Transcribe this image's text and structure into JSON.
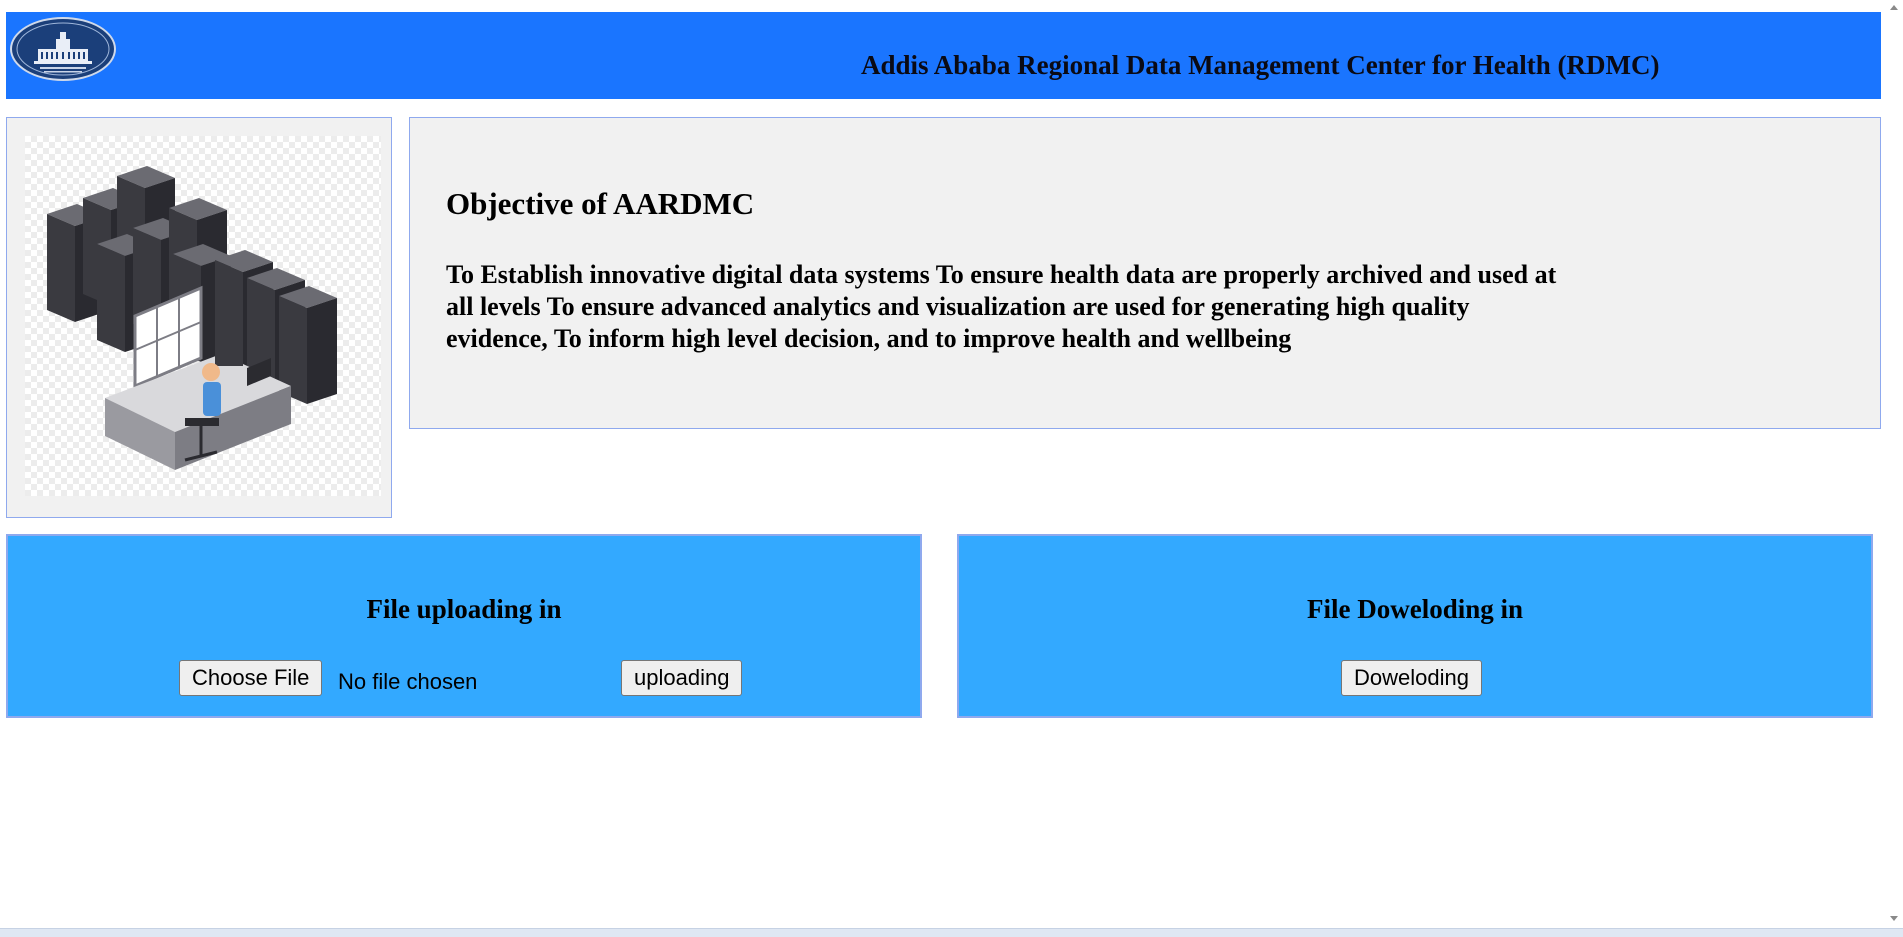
{
  "header": {
    "title": "Addis Ababa Regional Data Management Center for Health (RDMC)",
    "logo_icon": "building-seal-logo"
  },
  "hero": {
    "illustration_icon": "server-room-illustration"
  },
  "objective": {
    "heading": "Objective of AARDMC",
    "body": "To Establish innovative digital data systems To ensure health data are properly archived and used at all levels To ensure advanced analytics and visualization are used for generating high quality evidence, To inform high level decision, and to improve health and wellbeing"
  },
  "upload": {
    "heading": "File uploading in",
    "choose_file_label": "Choose File",
    "file_status": "No file chosen",
    "submit_label": "uploading"
  },
  "download": {
    "heading": "File Doweloding in",
    "button_label": "Doweloding"
  },
  "colors": {
    "header_bg": "#1a75ff",
    "card_bg": "#33a9ff",
    "panel_bg": "#f1f1f1",
    "panel_border": "#8fa9ee"
  }
}
